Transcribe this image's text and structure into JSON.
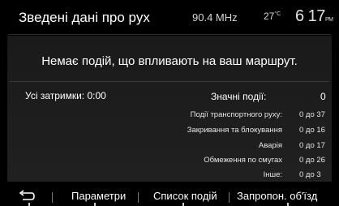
{
  "header": {
    "title": "Зведені дані про рух",
    "frequency": "90.4 MHz",
    "temperature": "27",
    "temperature_unit": "°C",
    "time": "6 17",
    "time_suffix": "PM"
  },
  "message": "Немає подій, що впливають на ваш маршрут.",
  "delays": {
    "label": "Усі затримки: 0:00"
  },
  "significant": {
    "label": "Значні події:",
    "value": "0"
  },
  "categories": [
    {
      "label": "Події транспортного руху:",
      "value": "0 до 37"
    },
    {
      "label": "Закривання та блокування",
      "value": "0 до 16"
    },
    {
      "label": "Аварія",
      "value": "0 до 17"
    },
    {
      "label": "Обмеження по смугах",
      "value": "0 до 26"
    },
    {
      "label": "Інше:",
      "value": "0 до 3"
    }
  ],
  "bottom_bar": {
    "back_icon": "return-arrow-icon",
    "settings": "Параметри",
    "event_list": "Список подій",
    "detour": "Запропон. об'їзд"
  }
}
